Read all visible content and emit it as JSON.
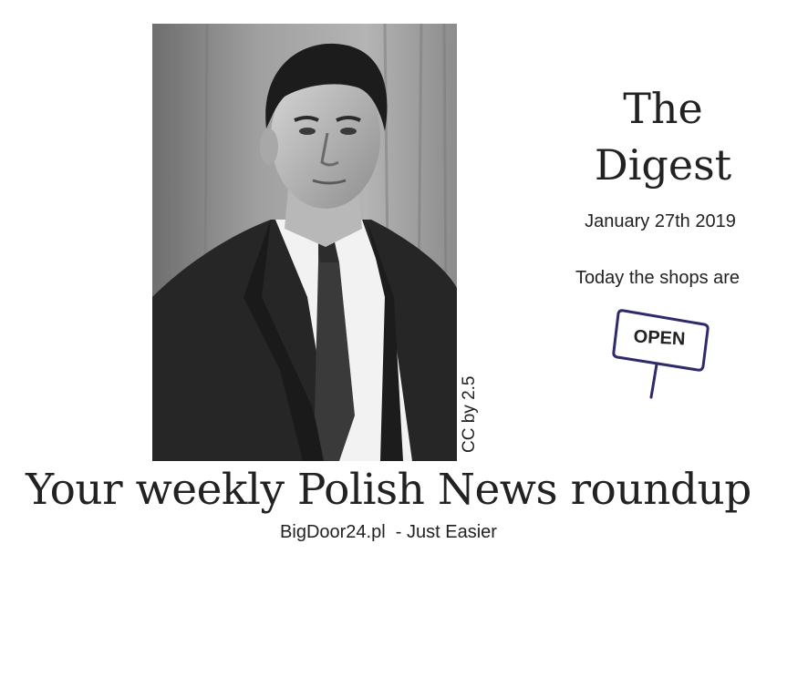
{
  "photo": {
    "credit": "CC by 2.5"
  },
  "masthead": {
    "title_line1": "The",
    "title_line2": "Digest",
    "date": "January 27th 2019",
    "shops_text": "Today the shops are",
    "sign_label": "OPEN"
  },
  "headline": "Your weekly Polish News roundup",
  "tagline": "BigDoor24.pl  - Just Easier",
  "colors": {
    "text": "#222222",
    "sign_outline": "#2e2a6b",
    "background": "#ffffff"
  }
}
